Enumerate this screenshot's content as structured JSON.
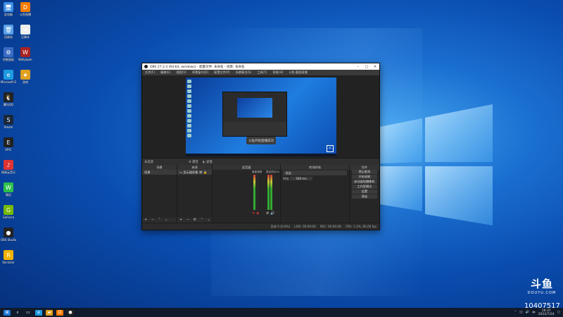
{
  "desktop": {
    "icons": [
      {
        "label": "此电脑",
        "glyph": "🖥",
        "color": "#3a8ee6"
      },
      {
        "label": "回收站",
        "glyph": "🗑",
        "color": "#5aa0e8"
      },
      {
        "label": "控制面板",
        "glyph": "⚙",
        "color": "#3b6cc4"
      },
      {
        "label": "Microsoft Edge",
        "glyph": "e",
        "color": "#1e9be0"
      },
      {
        "label": "腾讯QQ",
        "glyph": "🐧",
        "color": "#222"
      },
      {
        "label": "Steam",
        "glyph": "S",
        "color": "#1b2838"
      },
      {
        "label": "EPIC",
        "glyph": "E",
        "color": "#222"
      },
      {
        "label": "网易云音乐",
        "glyph": "♪",
        "color": "#d33"
      },
      {
        "label": "微信",
        "glyph": "W",
        "color": "#2cbf4a"
      },
      {
        "label": "GeForce",
        "glyph": "G",
        "color": "#76b900"
      },
      {
        "label": "OBS Studio",
        "glyph": "●",
        "color": "#222"
      },
      {
        "label": "Rockstar",
        "glyph": "R",
        "color": "#f3b200"
      },
      {
        "label": "斗鱼直播",
        "glyph": "D",
        "color": "#f57c00"
      },
      {
        "label": "记事本",
        "glyph": "≡",
        "color": "#eee"
      },
      {
        "label": "Wallpaper",
        "glyph": "W",
        "color": "#aa2222"
      },
      {
        "label": "游戏",
        "glyph": "★",
        "color": "#e0a020"
      }
    ]
  },
  "obs": {
    "title": "OBS 27.2.4 (64-bit, windows) - 配置文件: 未命名 - 场景: 未命名",
    "menu": [
      "文件(F)",
      "编辑(E)",
      "视图(V)",
      "停靠窗口(D)",
      "配置文件(P)",
      "场景集合(S)",
      "工具(T)",
      "帮助(H)",
      "斗鱼·截图直播"
    ],
    "preview_toast": "斗鱼开始直播成功",
    "dock_header": {
      "left": "未选源",
      "props": "⚙ 属性",
      "filters": "◐ 滤镜"
    },
    "scenes": {
      "header": "场景",
      "items": [
        "场景"
      ]
    },
    "sources": {
      "header": "来源",
      "items": [
        "显示器采集"
      ]
    },
    "mixer": {
      "header": "混音器",
      "ch1": "桌面音频",
      "ch2": "麦克风/Aux"
    },
    "transitions": {
      "header": "转场特效",
      "type": "淡出",
      "duration_label": "时长",
      "duration": "300 ms"
    },
    "controls": {
      "header": "控件",
      "buttons": [
        "停止推流",
        "开始录制",
        "启动虚拟摄像机",
        "工作室模式",
        "设置",
        "退出"
      ]
    },
    "status": {
      "drop": "丢帧 0 (0.0%)",
      "live": "LIVE: 00:00:00",
      "rec": "REC: 00:00:00",
      "cpu": "CPU: 1.3%, 60.00 fps"
    }
  },
  "watermark": {
    "logo": "斗鱼",
    "sub": "DOUYU.COM",
    "room": "10407517"
  },
  "taskbar": {
    "time": "16:37",
    "date": "2022/7/24",
    "lang": "中"
  }
}
